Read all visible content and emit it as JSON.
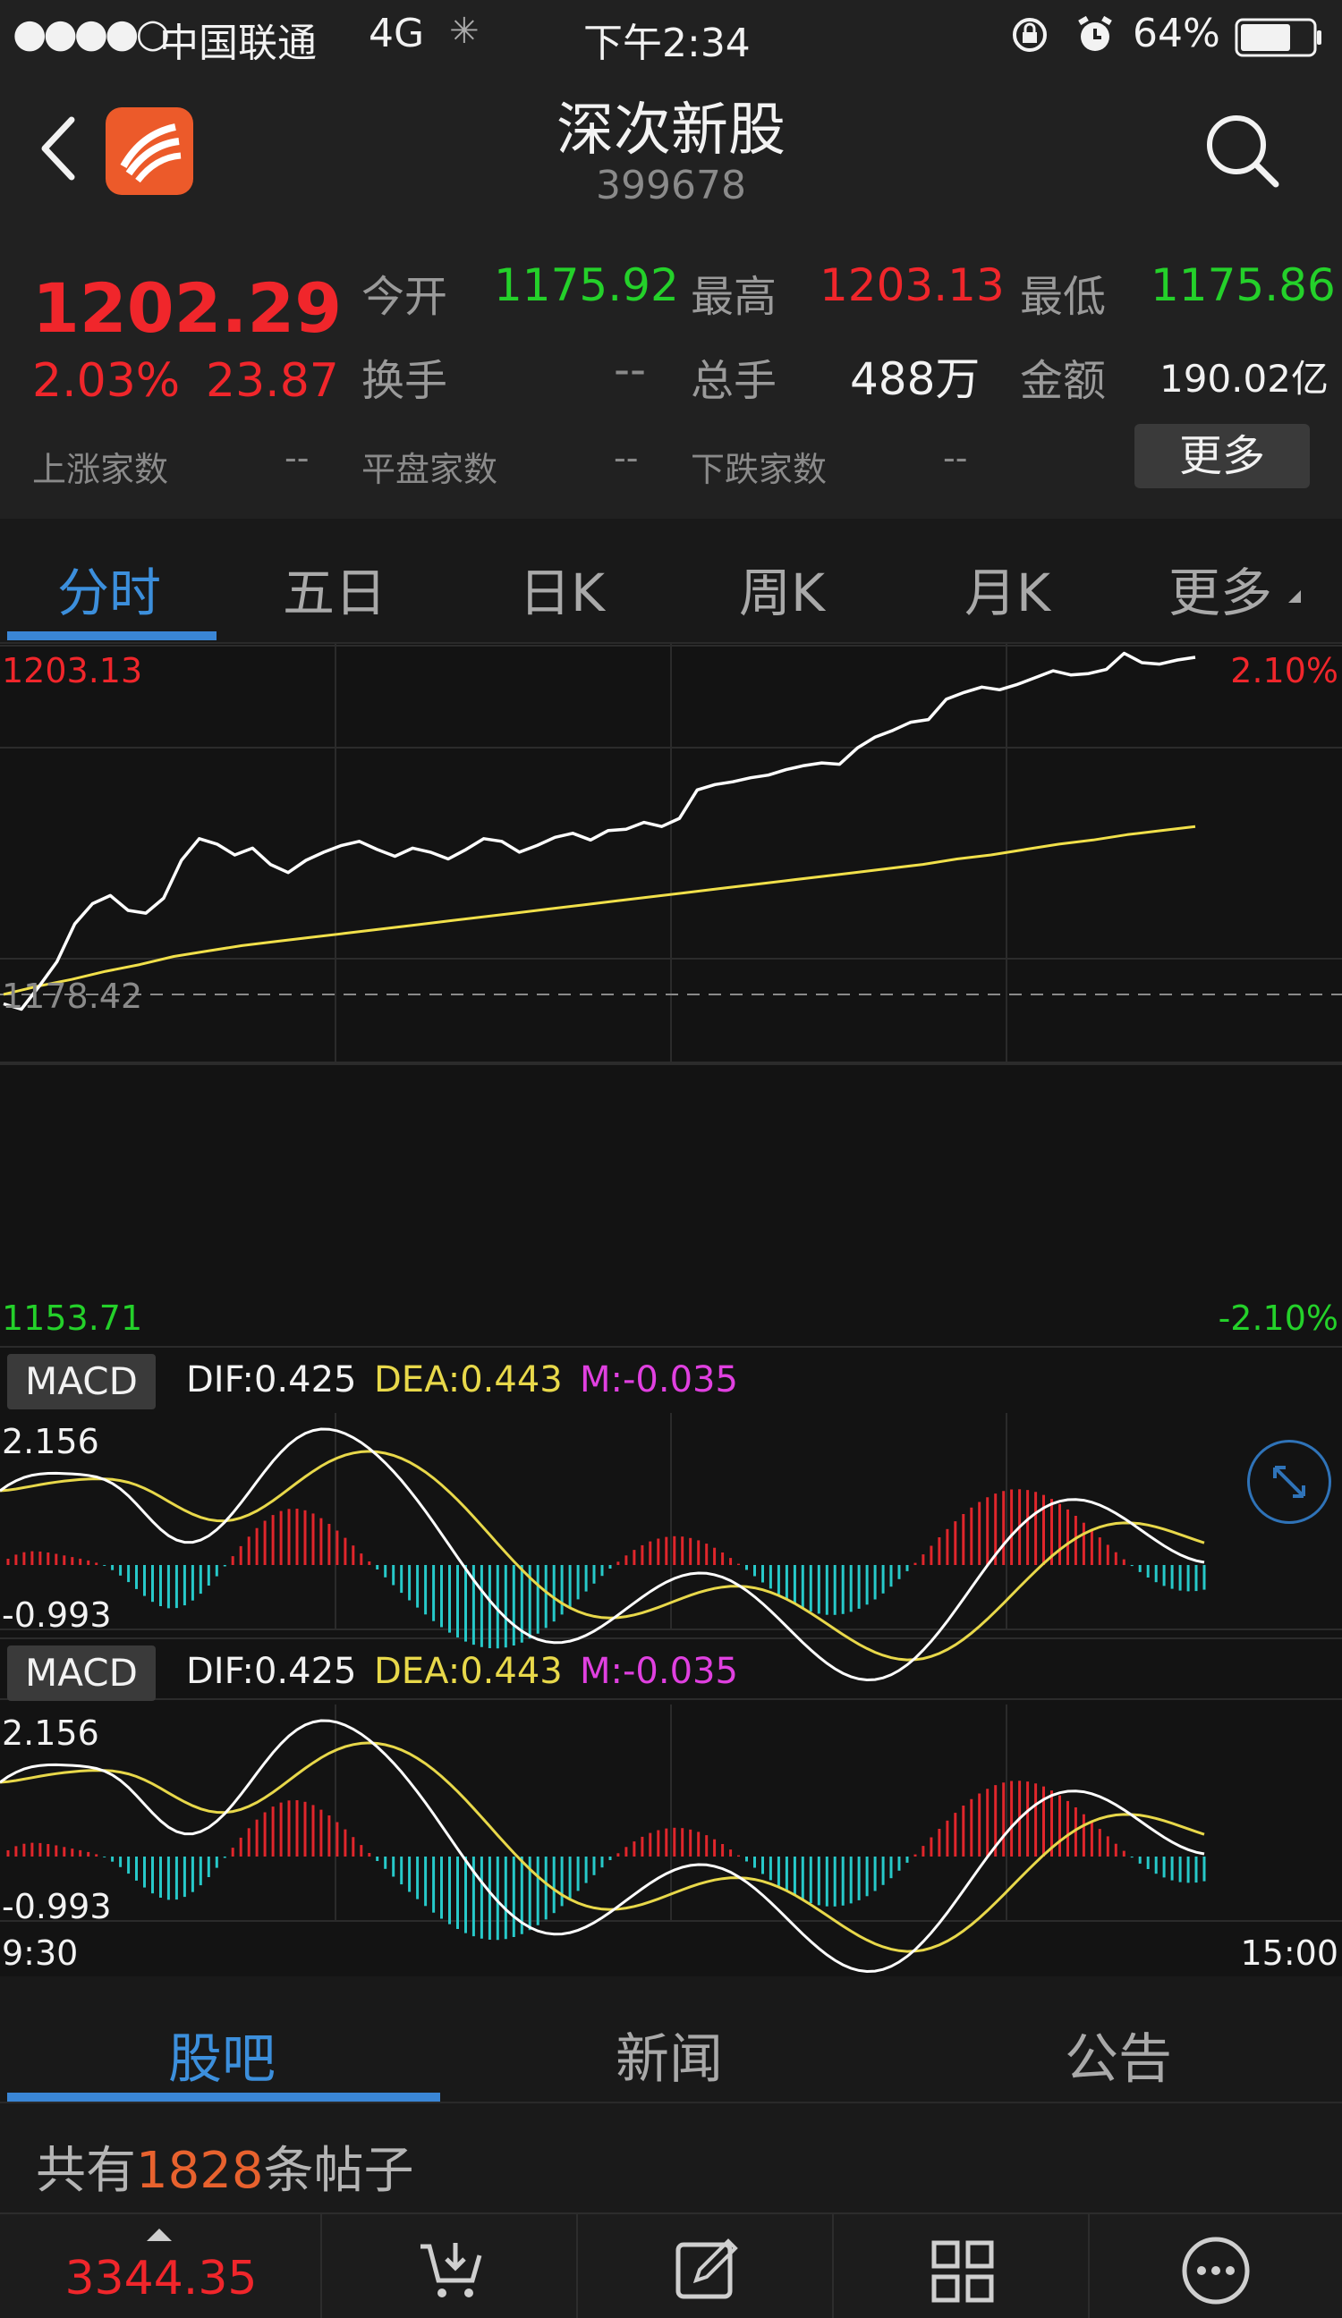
{
  "status_bar": {
    "signal": "●●●●○",
    "carrier": "中国联通",
    "network": "4G",
    "time": "下午2:34",
    "battery": "64%"
  },
  "header": {
    "title": "深次新股",
    "code": "399678"
  },
  "quote": {
    "price": "1202.29",
    "change_pct": "2.03%",
    "change": "23.87",
    "open_label": "今开",
    "open": "1175.92",
    "high_label": "最高",
    "high": "1203.13",
    "low_label": "最低",
    "low": "1175.86",
    "turnover_label": "换手",
    "turnover": "--",
    "volume_label": "总手",
    "volume": "488万",
    "amount_label": "金额",
    "amount": "190.02亿",
    "up_label": "上涨家数",
    "up": "--",
    "flat_label": "平盘家数",
    "flat": "--",
    "down_label": "下跌家数",
    "down": "--",
    "more": "更多"
  },
  "tabs": [
    "分时",
    "五日",
    "日K",
    "周K",
    "月K",
    "更多"
  ],
  "chart": {
    "top_price": "1203.13",
    "mid_price": "1178.42",
    "bottom_price": "1153.71",
    "top_pct": "2.10%",
    "bottom_pct": "-2.10%",
    "time_start": "9:30",
    "time_end": "15:00"
  },
  "macd": {
    "label": "MACD",
    "dif": "DIF:0.425",
    "dea": "DEA:0.443",
    "m": "M:-0.035",
    "max": "2.156",
    "min": "-0.993"
  },
  "sub_tabs": [
    "股吧",
    "新闻",
    "公告"
  ],
  "posts": {
    "prefix": "共有",
    "count": "1828",
    "suffix": "条帖子"
  },
  "footer": {
    "index_value": "3344.35"
  },
  "colors": {
    "up": "#f0262b",
    "down": "#24d12a",
    "accent": "#3a86d6",
    "price_line": "#ffffff",
    "avg_line": "#f1e04a",
    "dea_line": "#e8d84a",
    "macd_m": "#e040e0",
    "hist_up": "#e0262b",
    "hist_down": "#27c9c9"
  },
  "chart_data": {
    "type": "line",
    "ylim": [
      1153.71,
      1203.13
    ],
    "series": [
      {
        "values": [
          1177.2,
          1176.8,
          1178.5,
          1180.3,
          1183.1,
          1184.6,
          1185.2,
          1184.1,
          1183.9,
          1185.0,
          1187.8,
          1189.4,
          1189.0,
          1188.2,
          1188.7,
          1187.5,
          1186.9,
          1187.8,
          1188.4,
          1188.9,
          1189.2,
          1188.6,
          1188.1,
          1188.7,
          1188.4,
          1187.9,
          1188.6,
          1189.4,
          1189.2,
          1188.4,
          1188.9,
          1189.5,
          1189.8,
          1189.3,
          1190.0,
          1190.1,
          1190.6,
          1190.3,
          1190.9,
          1193.0,
          1193.4,
          1193.6,
          1193.9,
          1194.1,
          1194.5,
          1194.8,
          1195.0,
          1194.9,
          1196.1,
          1196.9,
          1197.4,
          1198.0,
          1198.2,
          1199.7,
          1200.2,
          1200.6,
          1200.4,
          1200.8,
          1201.3,
          1201.8,
          1201.5,
          1201.6,
          1201.9,
          1203.1,
          1202.4,
          1202.3,
          1202.6,
          1202.8
        ]
      },
      {
        "values": [
          1177.9,
          1178.5,
          1179.0,
          1179.6,
          1180.1,
          1180.7,
          1181.1,
          1181.5,
          1181.8,
          1182.1,
          1182.4,
          1182.7,
          1183.0,
          1183.3,
          1183.6,
          1183.9,
          1184.2,
          1184.5,
          1184.8,
          1185.1,
          1185.4,
          1185.7,
          1186.0,
          1186.3,
          1186.6,
          1186.9,
          1187.2,
          1187.5,
          1187.9,
          1188.2,
          1188.6,
          1189.0,
          1189.3,
          1189.7,
          1190.0,
          1190.3
        ]
      }
    ]
  }
}
